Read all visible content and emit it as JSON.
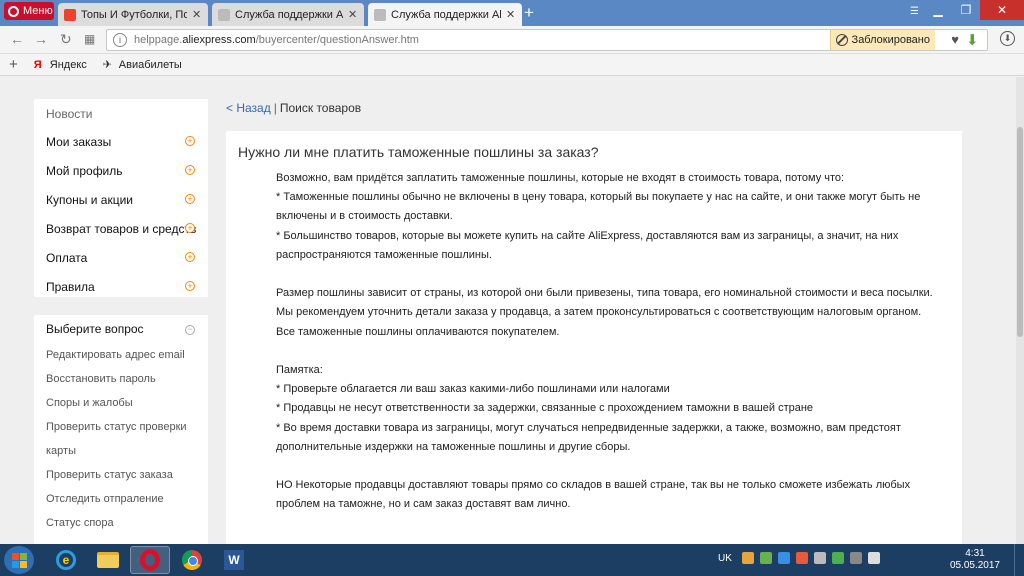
{
  "browser": {
    "menu_label": "Меню",
    "tabs": [
      {
        "label": "Топы И Футболки, Поло «",
        "favicon_color": "#e8452c"
      },
      {
        "label": "Служба поддержки AliExp",
        "favicon_color": "#999999"
      },
      {
        "label": "Служба поддержки AliExp",
        "favicon_color": "#999999"
      }
    ],
    "new_tab": "+",
    "url": {
      "prefix": "helppage.",
      "domain": "aliexpress.com",
      "path": "/buyercenter/questionAnswer.htm"
    },
    "blocked_label": "Заблокировано",
    "bookmarks": [
      {
        "label": "Яндекс",
        "icon": "yandex-icon"
      },
      {
        "label": "Авиабилеты",
        "icon": "plane-icon"
      }
    ]
  },
  "sidebar": {
    "news": "Новости",
    "items": [
      {
        "label": "Мои заказы"
      },
      {
        "label": "Мой профиль"
      },
      {
        "label": "Купоны и акции"
      },
      {
        "label": "Возврат товаров и средств"
      },
      {
        "label": "Оплата"
      },
      {
        "label": "Правила"
      }
    ],
    "questions_heading": "Выберите вопрос",
    "questions": [
      "Редактировать адрес email",
      "Восстановить пароль",
      "Споры и жалобы",
      "Проверить статус проверки",
      "карты",
      "Проверить статус заказа",
      "Отследить отпраление",
      "Статус спора"
    ]
  },
  "breadcrumb": {
    "back": "< Назад",
    "separator": "|",
    "current": "Поиск товаров"
  },
  "article": {
    "title": "Нужно ли мне платить таможенные пошлины за заказ?",
    "lines": [
      "Возможно, вам придётся заплатить таможенные пошлины, которые не входят в стоимость товара, потому что:",
      "* Таможенные пошлины обычно не включены в цену товара, который вы покупаете у нас на сайте, и они также могут быть не",
      "включены и в стоимость доставки.",
      "* Большинство товаров, которые вы можете купить на сайте AliExpress, доставляются вам из заграницы, а значит, на них",
      "распространяются таможенные пошлины.",
      "",
      "Размер пошлины зависит от страны, из которой они были привезены, типа товара, его номинальной стоимости и веса посылки.",
      "Мы рекомендуем уточнить детали заказа у продавца, а затем проконсультироваться с соответствующим налоговым органом.",
      "Все таможенные пошлины оплачиваются покупателем.",
      "",
      "Памятка:",
      "* Проверьте облагается ли ваш заказ какими-либо пошлинами или налогами",
      "* Продавцы не несут ответственности за задержки, связанные с прохождением таможни в вашей стране",
      "* Во время доставки товара из заграницы, могут случаться непредвиденные задержки, а также, возможно, вам предстоят",
      "дополнительные издержки на таможенные пошлины и другие сборы.",
      "",
      "НО Некоторые продавцы доставляют товары прямо со складов в вашей стране, так вы не только сможете избежать любых",
      "проблем на таможне, но и сам заказ доставят вам лично."
    ]
  },
  "taskbar": {
    "language": "UK",
    "time": "4:31",
    "date": "05.05.2017",
    "tray_colors": [
      "#e8a43a",
      "#6ab04c",
      "#3a8ee6",
      "#e85a3a",
      "#bbbbbb",
      "#4caf50",
      "#888888",
      "#dddddd"
    ]
  },
  "colors": {
    "accent_orange": "#f3870e",
    "link_blue": "#3966b0",
    "tabstrip": "#5a88c4",
    "taskbar": "#1d3e63"
  }
}
